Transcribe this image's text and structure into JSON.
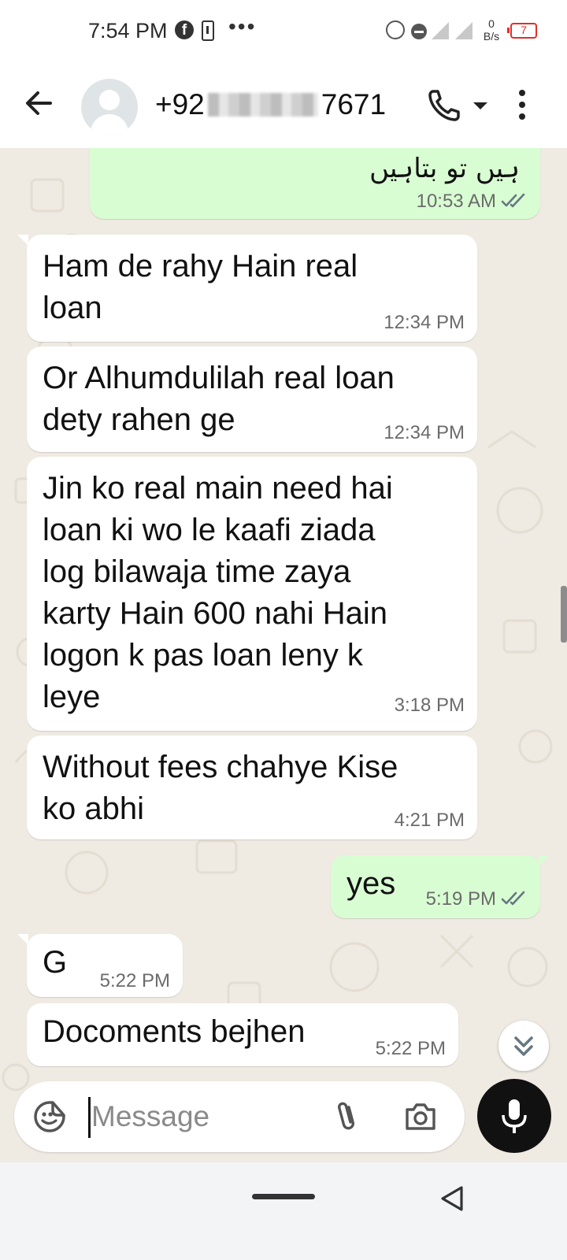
{
  "status_bar": {
    "time": "7:54 PM",
    "fb_glyph": "f",
    "more_dots": "•••",
    "net_speed_value": "0",
    "net_speed_unit": "B/s",
    "battery_level": "7",
    "icons": [
      "facebook-icon",
      "phone-storage-icon",
      "alarm-icon",
      "dnd-icon",
      "signal-icon",
      "battery-icon"
    ]
  },
  "header": {
    "contact_prefix": "+92",
    "contact_suffix": "7671",
    "icons": [
      "back-arrow-icon",
      "avatar-placeholder-icon",
      "phone-icon",
      "chevron-down-icon",
      "more-vert-icon"
    ]
  },
  "colors": {
    "chat_background": "#efeae2",
    "incoming_bubble": "#ffffff",
    "outgoing_bubble": "#d9fdd3",
    "read_tick": "#667781",
    "mic_button": "#111111"
  },
  "messages": [
    {
      "direction": "out",
      "text": "ہیں تو بتاہیں",
      "time": "10:53 AM",
      "status": "read"
    },
    {
      "direction": "in",
      "lines": [
        "Ham de rahy Hain real",
        "loan"
      ],
      "time": "12:34 PM"
    },
    {
      "direction": "in",
      "lines": [
        "Or Alhumdulilah real loan",
        "dety rahen ge"
      ],
      "time": "12:34 PM"
    },
    {
      "direction": "in",
      "lines": [
        "Jin ko real main need hai",
        "loan ki wo le kaafi ziada",
        "log bilawaja time zaya",
        "karty Hain 600 nahi Hain",
        "logon k pas loan leny k",
        "leye"
      ],
      "time": "3:18 PM"
    },
    {
      "direction": "in",
      "lines": [
        "Without fees chahye Kise",
        "ko abhi"
      ],
      "time": "4:21 PM"
    },
    {
      "direction": "out",
      "text": "yes",
      "time": "5:19 PM",
      "status": "read"
    },
    {
      "direction": "in",
      "text": "G",
      "time": "5:22 PM"
    },
    {
      "direction": "in",
      "text": "Docoments bejhen",
      "time": "5:22 PM"
    }
  ],
  "composer": {
    "placeholder": "Message",
    "value": "",
    "icons": [
      "sticker-emoji-icon",
      "paperclip-icon",
      "camera-icon",
      "microphone-icon"
    ]
  },
  "scroll_to_bottom_icon": "double-chevron-down-icon",
  "nav_bar": {
    "icons": [
      "home-pill-icon",
      "back-triangle-icon"
    ]
  }
}
